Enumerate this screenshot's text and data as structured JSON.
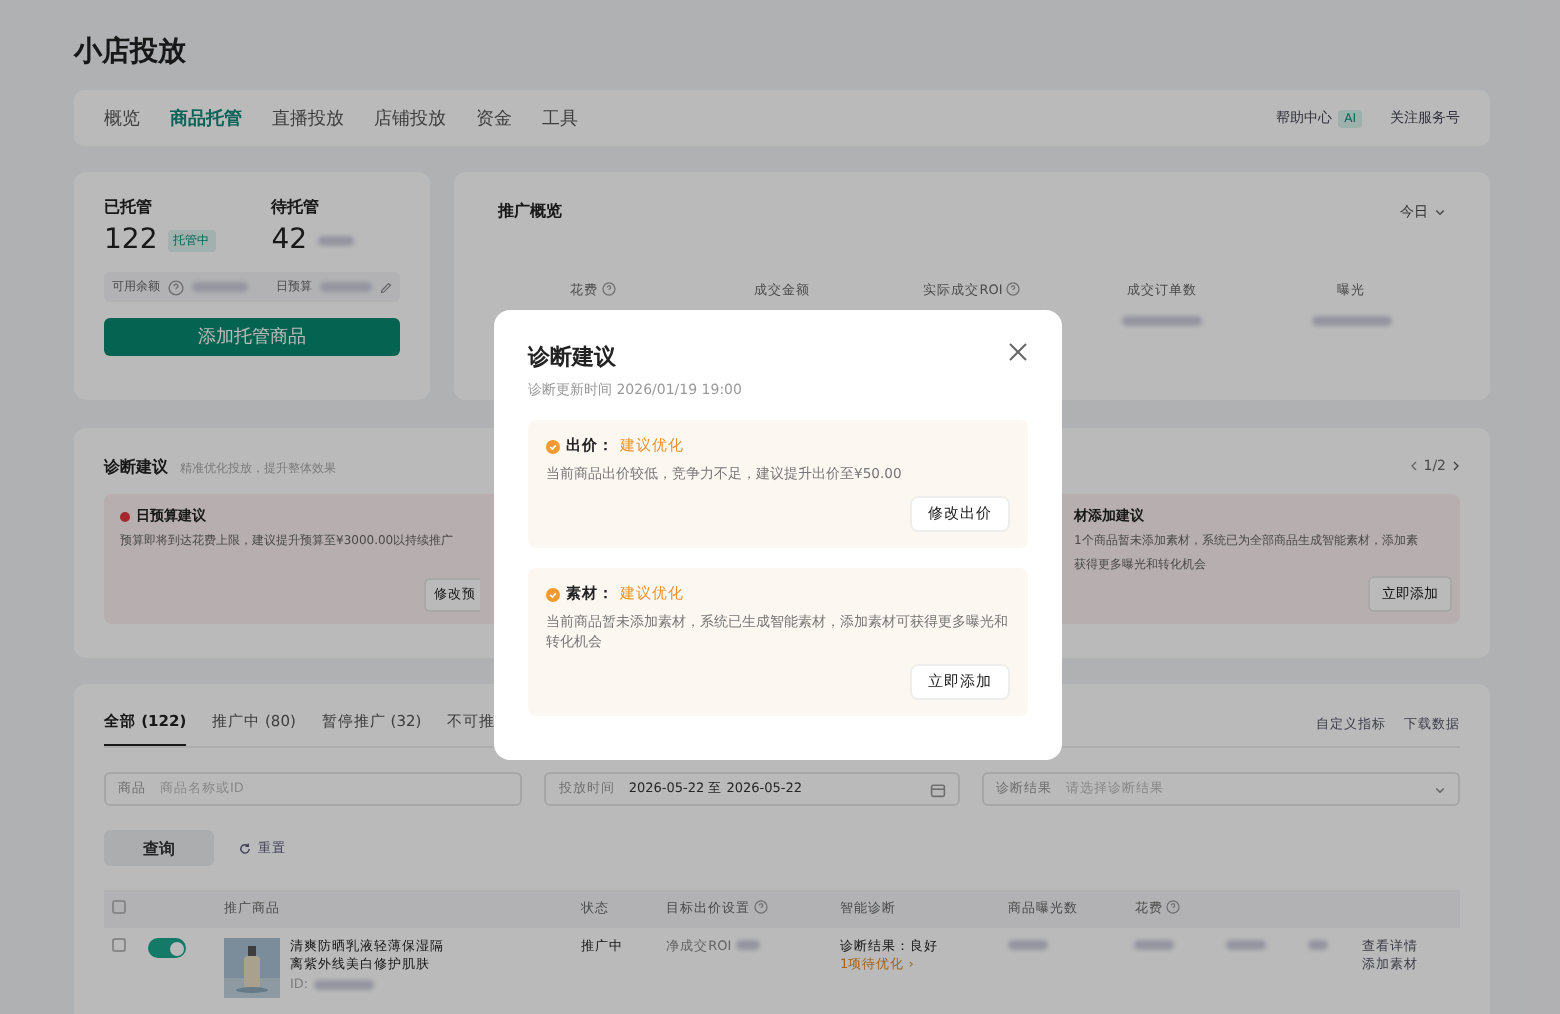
{
  "app_title": "小店投放",
  "nav": {
    "tabs": [
      {
        "label": "概览",
        "selected": false
      },
      {
        "label": "商品托管",
        "selected": true
      },
      {
        "label": "直播投放",
        "selected": false
      },
      {
        "label": "店铺投放",
        "selected": false
      },
      {
        "label": "资金",
        "selected": false
      },
      {
        "label": "工具",
        "selected": false
      }
    ],
    "links": [
      {
        "label": "帮助中心",
        "badge": "AI"
      },
      {
        "label": "关注服务号"
      }
    ]
  },
  "hosting": {
    "items": [
      {
        "label": "已托管",
        "value": "122",
        "badge": "托管中"
      },
      {
        "label": "待托管",
        "value": "42"
      }
    ],
    "balance_label": "可用余额",
    "budget_label": "日预算",
    "button": "添加托管商品"
  },
  "overview": {
    "title": "推广概览",
    "period": "今日",
    "metrics": [
      {
        "label": "花费",
        "help": true
      },
      {
        "label": "成交金额",
        "help": false
      },
      {
        "label": "实际成交ROI",
        "help": true
      },
      {
        "label": "成交订单数",
        "help": false
      },
      {
        "label": "曝光",
        "help": false
      }
    ]
  },
  "diagnosis": {
    "title": "诊断建议",
    "subtitle": "精准优化投放，提升整体效果",
    "pager": "1/2",
    "cards": [
      {
        "title": "日预算建议",
        "lines": [
          "预算即将到达花费上限，建议提升预算至¥3000.00以持续推广"
        ],
        "button": "修改预"
      },
      {
        "title": "材添加建议",
        "lines": [
          "1个商品暂未添加素材，系统已为全部商品生成智能素材，添加素",
          "获得更多曝光和转化机会"
        ],
        "button": "立即添加"
      }
    ]
  },
  "products": {
    "tabs": [
      {
        "label": "全部 (122)",
        "selected": true
      },
      {
        "label": "推广中 (80)",
        "selected": false
      },
      {
        "label": "暂停推广 (32)",
        "selected": false
      },
      {
        "label": "不可推",
        "selected": false
      }
    ],
    "actions": [
      "自定义指标",
      "下载数据"
    ],
    "filters": [
      {
        "kind": "text",
        "label": "商品",
        "placeholder": "商品名称或ID"
      },
      {
        "kind": "date",
        "label": "投放时间",
        "value": "2026-05-22 至 2026-05-22"
      },
      {
        "kind": "select",
        "label": "诊断结果",
        "placeholder": "请选择诊断结果"
      }
    ],
    "query_button": "查询",
    "reset_button": "重置",
    "select_all_checked": false,
    "columns": [
      {
        "label": "推广商品",
        "help": false
      },
      {
        "label": "状态",
        "help": false
      },
      {
        "label": "目标出价设置",
        "help": true
      },
      {
        "label": "智能诊断",
        "help": false
      },
      {
        "label": "商品曝光数",
        "help": false
      },
      {
        "label": "花费",
        "help": true
      }
    ],
    "rows": [
      {
        "checked": false,
        "on": true,
        "name": "清爽防晒乳液轻薄保湿隔离紫外线美白修护肌肤",
        "id_label": "ID:",
        "status": "推广中",
        "bid_type": "净成交ROI",
        "diagnosis": "诊断结果：良好",
        "todo": "1项待优化 ›",
        "actions": [
          "查看详情",
          "添加素材"
        ]
      }
    ]
  },
  "dialog": {
    "title": "诊断建议",
    "updated": "诊断更新时间 2026/01/19 19:00",
    "items": [
      {
        "label": "出价：",
        "status": "建议优化",
        "lines": [
          "当前商品出价较低，竞争力不足，建议提升出价至¥50.00"
        ],
        "button": "修改出价"
      },
      {
        "label": "素材：",
        "status": "建议优化",
        "lines": [
          "当前商品暂未添加素材，系统已生成智能素材，添加素材可获得更多曝光和转化机会"
        ],
        "button": "立即添加"
      }
    ]
  }
}
